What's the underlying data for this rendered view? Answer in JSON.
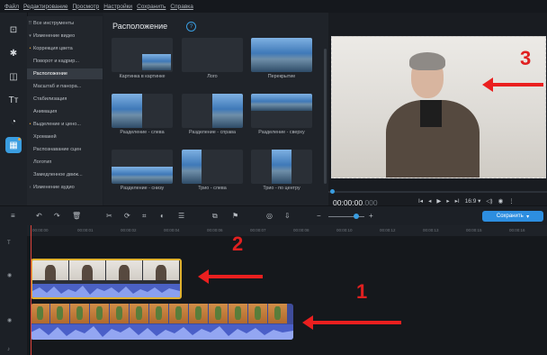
{
  "menubar": {
    "items": [
      "Файл",
      "Редактирование",
      "Просмотр",
      "Настройки",
      "Сохранить",
      "Справка"
    ]
  },
  "left_strip": {
    "icons": [
      "import-icon",
      "magic-wand-icon",
      "transitions-icon",
      "titles-icon",
      "stickers-icon",
      "more-tools-icon"
    ]
  },
  "tools": {
    "items": [
      {
        "label": "Все инструменты",
        "icon": "grid"
      },
      {
        "label": "Изменение видео",
        "icon": "chevron"
      },
      {
        "label": "Коррекция цвета",
        "icon": "dot"
      },
      {
        "label": "Поворот и кадрир...",
        "icon": ""
      },
      {
        "label": "Расположение",
        "icon": ""
      },
      {
        "label": "Масштаб и панора...",
        "icon": ""
      },
      {
        "label": "Стабилизация",
        "icon": ""
      },
      {
        "label": "Анимация",
        "icon": ""
      },
      {
        "label": "Выделение и цено...",
        "icon": "dot"
      },
      {
        "label": "Хромакей",
        "icon": ""
      },
      {
        "label": "Распознавание сцен",
        "icon": ""
      },
      {
        "label": "Логотип",
        "icon": ""
      },
      {
        "label": "Замедленное движ...",
        "icon": ""
      },
      {
        "label": "Изменение аудио",
        "icon": "chevron"
      }
    ]
  },
  "panel": {
    "title": "Расположение",
    "help": "?",
    "tiles": [
      "Картинка в картинке",
      "Лого",
      "Перекрытие",
      "Разделение - слева",
      "Разделение - справа",
      "Разделение - сверху",
      "Разделение - снизу",
      "Трио - слева",
      "Трио - по центру"
    ]
  },
  "preview": {
    "timecode": "00:00:00",
    "timecode_frac": ".000",
    "controls": [
      "I◂",
      "◂",
      "▶",
      "▸",
      "▸I",
      "16:9 ▾",
      "◁)",
      "◉",
      "⋮"
    ]
  },
  "timeline_toolbar": {
    "icons": [
      "undo-icon",
      "redo-icon",
      "delete-icon",
      "cut-icon",
      "rotate-icon",
      "crop-icon",
      "color-icon",
      "adjust-icon",
      "insert-icon",
      "flag-icon",
      "record-icon",
      "mic-icon"
    ],
    "zoom_minus": "−",
    "zoom_plus": "+",
    "save_label": "Сохранить",
    "save_arrow": "▾"
  },
  "timeline": {
    "ruler": [
      "00:00:00",
      "00:00:01",
      "00:00:02",
      "00:00:04",
      "00:00:06",
      "00:00:07",
      "00:00:08",
      "00:00:10",
      "00:00:12",
      "00:00:13",
      "00:00:15",
      "00:00:16"
    ]
  },
  "annotations": {
    "numbers": [
      "1",
      "2",
      "3"
    ]
  },
  "colors": {
    "accent": "#2d8ee0",
    "selection": "#e0b12e",
    "annotation": "#ea1f1f",
    "playhead": "#e0443c"
  }
}
